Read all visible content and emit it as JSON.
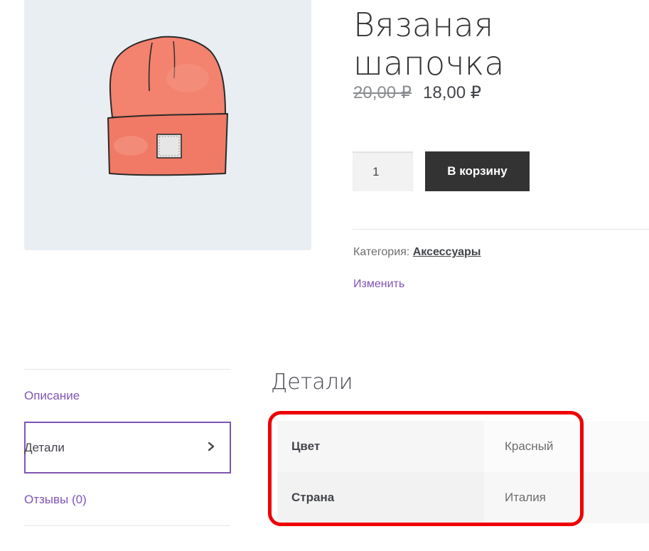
{
  "product": {
    "title": "Вязаная шапочка",
    "price_old": "20,00 ₽",
    "price_new": "18,00 ₽",
    "quantity": "1",
    "add_to_cart_label": "В корзину",
    "category_label": "Категория:",
    "category_link": "Аксессуары",
    "edit_label": "Изменить",
    "image_icon": "beanie-hat-image"
  },
  "tabs": [
    {
      "label": "Описание",
      "active": false
    },
    {
      "label": "Детали",
      "active": true
    },
    {
      "label": "Отзывы (0)",
      "active": false
    }
  ],
  "details": {
    "title": "Детали",
    "rows": [
      {
        "name": "Цвет",
        "value": "Красный"
      },
      {
        "name": "Страна",
        "value": "Италия"
      }
    ]
  },
  "colors": {
    "accent": "#7f54b3",
    "button": "#333333",
    "highlight": "#ee0000",
    "hat": "#f3826e"
  }
}
